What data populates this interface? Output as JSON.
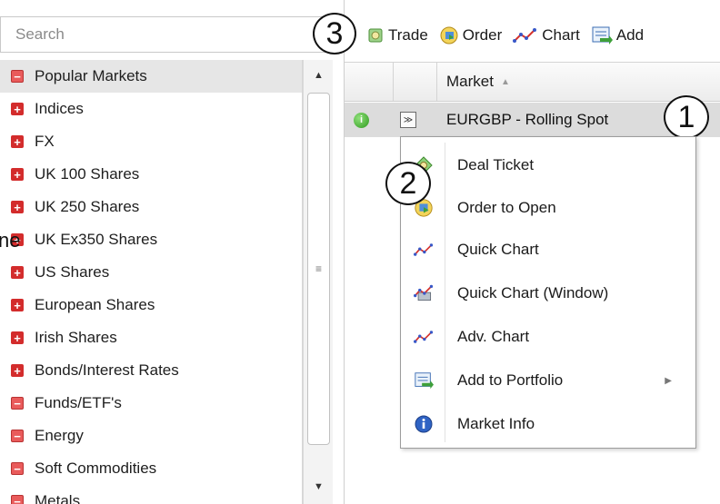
{
  "search": {
    "placeholder": "Search"
  },
  "tree": {
    "items": [
      {
        "label": "Popular Markets",
        "icon": "collapse",
        "selected": true
      },
      {
        "label": "Indices",
        "icon": "expand"
      },
      {
        "label": "FX",
        "icon": "expand"
      },
      {
        "label": "UK 100 Shares",
        "icon": "expand"
      },
      {
        "label": "UK 250 Shares",
        "icon": "expand"
      },
      {
        "label": "UK Ex350 Shares",
        "icon": "expand"
      },
      {
        "label": "US Shares",
        "icon": "expand"
      },
      {
        "label": "European Shares",
        "icon": "expand"
      },
      {
        "label": "Irish Shares",
        "icon": "expand"
      },
      {
        "label": "Bonds/Interest Rates",
        "icon": "expand"
      },
      {
        "label": "Funds/ETF's",
        "icon": "collapse"
      },
      {
        "label": "Energy",
        "icon": "collapse"
      },
      {
        "label": "Soft Commodities",
        "icon": "collapse"
      },
      {
        "label": "Metals",
        "icon": "collapse"
      }
    ],
    "left_edge_text": "ne"
  },
  "toolbar": {
    "callout_number": "3",
    "trade_label": "Trade",
    "order_label": "Order",
    "chart_label": "Chart",
    "add_label": "Add"
  },
  "grid": {
    "header_market": "Market",
    "row": {
      "label": "EURGBP - Rolling Spot",
      "callout_number": "1"
    }
  },
  "context_menu": {
    "callout_number": "2",
    "items": [
      {
        "label": "Deal Ticket",
        "icon": "deal-ticket-icon"
      },
      {
        "label": "Order to Open",
        "icon": "order-icon"
      },
      {
        "label": "Quick Chart",
        "icon": "chart-icon"
      },
      {
        "label": "Quick Chart (Window)",
        "icon": "chart-window-icon"
      },
      {
        "label": "Adv. Chart",
        "icon": "chart-icon"
      },
      {
        "label": "Add to Portfolio",
        "icon": "portfolio-icon",
        "submenu": true
      },
      {
        "label": "Market Info",
        "icon": "info-icon"
      }
    ]
  },
  "colors": {
    "tree_icon_red": "#d32c2c",
    "selected_row": "#dcdcdc",
    "menu_border": "#9c9c9c"
  }
}
